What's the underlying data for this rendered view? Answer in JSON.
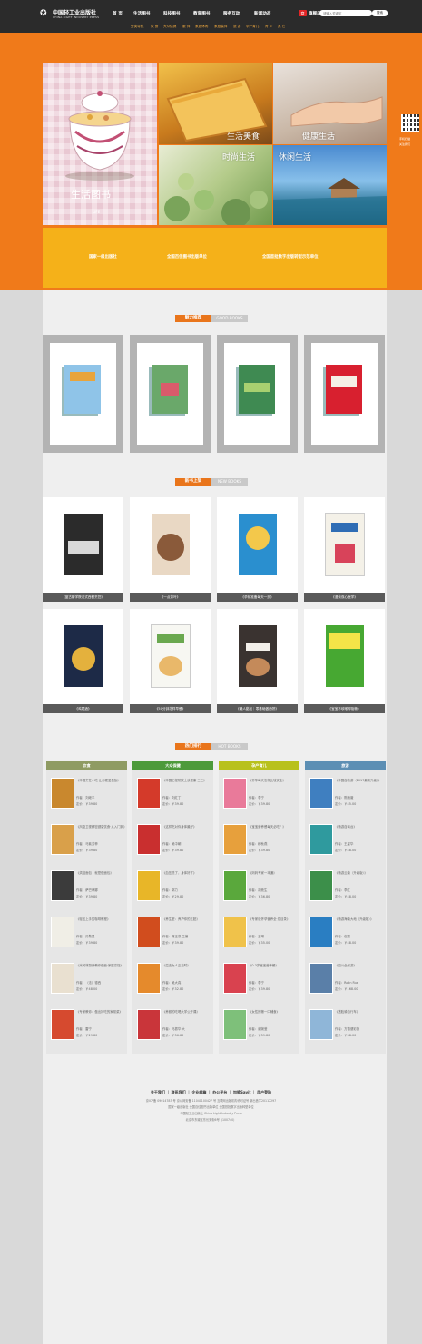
{
  "header": {
    "logo_cn": "中国轻工业出版社",
    "logo_en": "CHINA LIGHT INDUSTRY PRESS",
    "nav": [
      "首 页",
      "生活图书",
      "科技图书",
      "教育图书",
      "服务互动",
      "新闻动态"
    ],
    "shop_badge": "商",
    "shop_label": "旗舰店",
    "search_placeholder": "请输入关键字",
    "search_button": "搜索",
    "subnav": [
      "分类导航",
      "饮 食",
      "大众保健",
      "服 饰",
      "家居休闲",
      "家庭装饰",
      "旅 游",
      "孕产育儿",
      "青 少",
      "其 它"
    ]
  },
  "hero": {
    "life_title": "生活图书",
    "life_sub": "LIFE",
    "tiles": [
      "生活美食",
      "健康生活",
      "时尚生活",
      "休闲生活"
    ],
    "awards": [
      "国家一级出版社",
      "全国百佳图书出版单位",
      "全国首批数字出版转型示范单位"
    ]
  },
  "qr": {
    "lines": [
      "手机扫描",
      "关注我们"
    ]
  },
  "sections": {
    "recommend": {
      "cn": "魅力推荐",
      "en": "GOOD BOOKS"
    },
    "new_books": {
      "cn": "新书上架",
      "en": "NEW BOOKS"
    },
    "ranking": {
      "cn": "热门排行",
      "en": "HOT BOOKS"
    }
  },
  "recommend_books": [
    {
      "color": "#8fc4e8",
      "accent": "#e8a43c"
    },
    {
      "color": "#6aa86a",
      "accent": "#d95b6b"
    },
    {
      "color": "#3f8a52",
      "accent": "#a8d070"
    },
    {
      "color": "#d8202f",
      "accent": "#f5f0e6"
    }
  ],
  "new_books": [
    {
      "caption": "《蓝古斯学院法式西餐烹饪》",
      "color": "#2b2b2b",
      "accent": "#d9d9d9"
    },
    {
      "caption": "《一点茶叶》",
      "color": "#8a5a3a",
      "accent": "#e9d8c4"
    },
    {
      "caption": "《孕前准备每天一页》",
      "color": "#2a8fcf",
      "accent": "#f3c84b"
    },
    {
      "caption": "《漫谈双心医学》",
      "color": "#f4f1e8",
      "accent": "#d8435a"
    },
    {
      "caption": "《鸡尾酒》",
      "color": "#1d2a47",
      "accent": "#e4b13d"
    },
    {
      "caption": "《50分钟花样早餐》",
      "color": "#f7f7f2",
      "accent": "#6aa84f"
    },
    {
      "caption": "《懒人甜品｜零基础做西饼》",
      "color": "#3a3330",
      "accent": "#f2efe9"
    },
    {
      "caption": "《宝宝不咳嗽呼吸畅》",
      "color": "#47a832",
      "accent": "#f3e448"
    }
  ],
  "ranking": [
    {
      "title": "饮食",
      "color": "#8f9b63",
      "items": [
        {
          "title": "《中国烹饪小吃·让你更爱做饭》",
          "author": "作者：刘继平",
          "price": "定价：￥39.80",
          "color": "#c9882e"
        },
        {
          "title": "《凤凰卫视解密健康饮食·从入门到》",
          "author": "作者：马紫芳菲",
          "price": "定价：￥39.80",
          "color": "#d9a04a"
        },
        {
          "title": "《烘焙面包｜就是做面包》",
          "author": "作者：萨巴蒂娜",
          "price": "定价：￥39.80",
          "color": "#3b3b3b"
        },
        {
          "title": "《轻松上手的咖啡教程》",
          "author": "作者：贝勒里",
          "price": "定价：￥39.80",
          "color": "#f0eee6"
        },
        {
          "title": "《米其林厨师教你做西·家庭烹饪》",
          "author": "作者：（法）德西",
          "price": "定价：￥48.00",
          "color": "#e9e0d0"
        },
        {
          "title": "《专家教你：做出好吃的家常菜》",
          "author": "作者：雷宁",
          "price": "定价：￥29.80",
          "color": "#d64a2f"
        }
      ]
    },
    {
      "title": "大众保健",
      "color": "#4d9a3b",
      "items": [
        {
          "title": "《中国工程院院士谈健康·三三》",
          "author": "作者：刘红丁",
          "price": "定价：￥39.80",
          "color": "#d43a2a"
        },
        {
          "title": "《这样吃对你身体最好》",
          "author": "作者：吴中朝",
          "price": "定价：￥39.80",
          "color": "#c92f2f"
        },
        {
          "title": "《血压低了，身体好了》",
          "author": "作者：郭力",
          "price": "定价：￥29.80",
          "color": "#e8b628"
        },
        {
          "title": "《养生堂：养护你的五脏》",
          "author": "作者：蒋玉泉 主编",
          "price": "定价：￥39.80",
          "color": "#d14d1e"
        },
        {
          "title": "《溢血女人正当时》",
          "author": "作者：吴大真",
          "price": "定价：￥32.80",
          "color": "#e58a2c"
        },
        {
          "title": "《养颜的吃喝大学公开课》",
          "author": "作者：马振华 大",
          "price": "定价：￥36.80",
          "color": "#c9353a"
        }
      ]
    },
    {
      "title": "孕产育儿",
      "color": "#b8c11c",
      "items": [
        {
          "title": "《怀孕每天怎样比较安全》",
          "author": "作者：李宁",
          "price": "定价：￥39.80",
          "color": "#e97a9a"
        },
        {
          "title": "《宝宝营养餐每天必吃？》",
          "author": "作者：穆秋燕",
          "price": "定价：￥39.80",
          "color": "#e7a03c"
        },
        {
          "title": "《妈妈专家一本通》",
          "author": "作者：胡竞生",
          "price": "定价：￥36.80",
          "color": "#5aa83c"
        },
        {
          "title": "《专家说怀孕营养全·总目录》",
          "author": "作者：王琳",
          "price": "定价：￥35.00",
          "color": "#f0c24a"
        },
        {
          "title": "《0-3岁宝宝营养餐》",
          "author": "作者：李宁",
          "price": "定价：￥39.80",
          "color": "#d9424f"
        },
        {
          "title": "《女性的第一口辅食》",
          "author": "作者：谢婉莹",
          "price": "定价：￥39.80",
          "color": "#7ec07a"
        }
      ]
    },
    {
      "title": "旅游",
      "color": "#5d8fb4",
      "items": [
        {
          "title": "《中国自助游（2017最新升级）》",
          "author": "作者：陈雨薇",
          "price": "定价：￥45.00",
          "color": "#3f7fc0"
        },
        {
          "title": "《畅游自驾台》",
          "author": "作者：王星华",
          "price": "定价：￥48.00",
          "color": "#2f9a9e"
        },
        {
          "title": "《畅游云南（升级版）》",
          "author": "作者：李红",
          "price": "定价：￥48.00",
          "color": "#3c8f4a"
        },
        {
          "title": "《畅游海南大地（升级版）》",
          "author": "作者：包颖",
          "price": "定价：￥48.00",
          "color": "#2a7ec2"
        },
        {
          "title": "《四川全景游》",
          "author": "作者：Rolin Rue",
          "price": "定价：￥168.00",
          "color": "#5a7fa8"
        },
        {
          "title": "《搭脸骑自行车》",
          "author": "作者：方德健彩旅",
          "price": "定价：￥38.00",
          "color": "#8fb6d8"
        }
      ]
    }
  ],
  "footer": {
    "links": [
      "关于我们",
      "联系我们",
      "企业邮箱",
      "办公平台",
      "加盟Sayit",
      "用户登陆"
    ],
    "lines": [
      "京ICP备 09014783 号 京公网安备 11040100427 号 互联网出版机构许可证号 新出音字20112297",
      "国家一级出版社  全国百佳图书出版单位  全国首批数字出版转型单位",
      "中国轻工业出版社  China Light Industry Press",
      "北京市东城区东长安街6号（100740）"
    ]
  }
}
